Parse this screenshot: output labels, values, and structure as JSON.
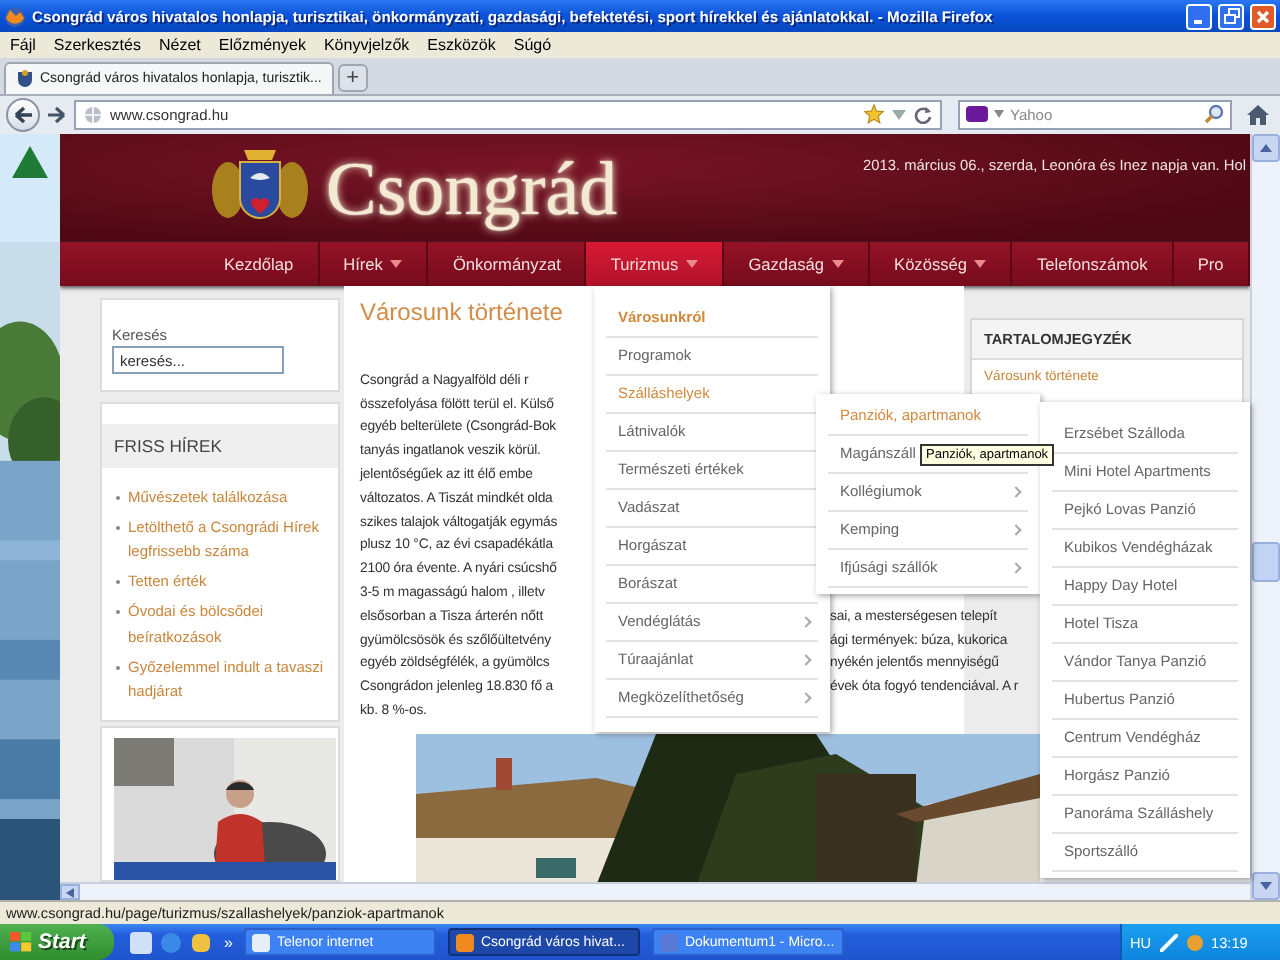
{
  "window": {
    "title": "Csongrád város hivatalos honlapja, turisztikai, önkormányzati, gazdasági, befektetési, sport hírekkel és ajánlatokkal. - Mozilla Firefox"
  },
  "menu_bar": [
    "Fájl",
    "Szerkesztés",
    "Nézet",
    "Előzmények",
    "Könyvjelzők",
    "Eszközök",
    "Súgó"
  ],
  "tabs": [
    {
      "label": "Csongrád város hivatalos honlapja, turisztik...",
      "selected": true
    }
  ],
  "new_tab": "+",
  "address_bar": {
    "url": "www.csongrad.hu"
  },
  "search": {
    "placeholder": "Yahoo"
  },
  "site": {
    "title": "Csongrád",
    "date": "2013. március 06., szerda, Leonóra és Inez napja van. Hol",
    "nav": [
      {
        "label": "Kezdőlap",
        "dropdown": false,
        "selected": false
      },
      {
        "label": "Hírek",
        "dropdown": true,
        "selected": false
      },
      {
        "label": "Önkormányzat",
        "dropdown": false,
        "selected": false
      },
      {
        "label": "Turizmus",
        "dropdown": true,
        "selected": true
      },
      {
        "label": "Gazdaság",
        "dropdown": true,
        "selected": false
      },
      {
        "label": "Közösség",
        "dropdown": true,
        "selected": false
      },
      {
        "label": "Telefonszámok",
        "dropdown": false,
        "selected": false
      },
      {
        "label": "Pro",
        "dropdown": false,
        "selected": false
      }
    ],
    "search": {
      "label": "Keresés",
      "value": "keresés..."
    },
    "news": {
      "heading": "FRISS HÍREK",
      "items": [
        "Művészetek találkozása",
        "Letölthető a Csongrádi Hírek legfrissebb száma",
        "Tetten érték",
        "Óvodai és bölcsődei beíratkozások",
        "Győzelemmel indult a tavaszi hadjárat"
      ]
    },
    "article": {
      "title": "Városunk története",
      "lines": [
        {
          "left": "Csongrád a Nagyalföld déli r"
        },
        {
          "left": "összefolyása fölött terül el. Külső"
        },
        {
          "left": "egyéb belterülete (Csongrád-Bok"
        },
        {
          "left": "tanyás ingatlanok veszik körül."
        },
        {
          "left": "jelentőségűek az itt élő embe"
        },
        {
          "left": "változatos. A Tiszát mindkét olda"
        },
        {
          "left": "szikes talajok váltogatják egymás"
        },
        {
          "left": "plusz 10 °C, az évi csapadékátla"
        },
        {
          "left": "2100 óra évente. A nyári csúcshő"
        },
        {
          "left": "3-5 m magasságú halom , illetv"
        },
        {
          "left": "elsősorban a Tisza árterén nőtt",
          "right": "sai, a mesterségesen telepít"
        },
        {
          "left": "gyümölcsösök és szőlőültetvény",
          "right": "ági termények: búza, kukorica"
        },
        {
          "left": "egyéb zöldségfélék, a gyümölcs",
          "right": "nyékén jelentős mennyiségű"
        },
        {
          "left": "Csongrádon jelenleg 18.830 fő a",
          "right": "évek óta fogyó tendenciával. A r"
        },
        {
          "left": "kb. 8 %-os."
        }
      ]
    },
    "toc": {
      "heading": "TARTALOMJEGYZÉK",
      "items": [
        "Városunk története"
      ]
    },
    "menus": [
      {
        "items": [
          {
            "label": "Városunkról",
            "selected": true,
            "current": true,
            "submenu": false
          },
          {
            "label": "Programok",
            "selected": false,
            "current": false,
            "submenu": false
          },
          {
            "label": "Szálláshelyek",
            "selected": true,
            "current": false,
            "submenu": false
          },
          {
            "label": "Látnivalók",
            "selected": false,
            "current": false,
            "submenu": false
          },
          {
            "label": "Természeti értékek",
            "selected": false,
            "current": false,
            "submenu": false
          },
          {
            "label": "Vadászat",
            "selected": false,
            "current": false,
            "submenu": false
          },
          {
            "label": "Horgászat",
            "selected": false,
            "current": false,
            "submenu": false
          },
          {
            "label": "Borászat",
            "selected": false,
            "current": false,
            "submenu": false
          },
          {
            "label": "Vendéglátás",
            "selected": false,
            "current": false,
            "submenu": true
          },
          {
            "label": "Túraajánlat",
            "selected": false,
            "current": false,
            "submenu": true
          },
          {
            "label": "Megközelíthetőség",
            "selected": false,
            "current": false,
            "submenu": true
          }
        ]
      },
      {
        "items": [
          {
            "label": "Panziók, apartmanok",
            "selected": true,
            "submenu": false
          },
          {
            "label": "Magánszáll",
            "selected": false
          },
          {
            "label": "Kollégiumok",
            "selected": false,
            "submenu": true
          },
          {
            "label": "Kemping",
            "selected": false,
            "submenu": true
          },
          {
            "label": "Ifjúsági szállók",
            "selected": false,
            "submenu": true
          }
        ]
      },
      {
        "items": [
          {
            "label": "Erzsébet Szálloda",
            "selected": false,
            "submenu": false
          },
          {
            "label": "Mini Hotel Apartments",
            "selected": false,
            "submenu": false
          },
          {
            "label": "Pejkó Lovas Panzió",
            "selected": false,
            "submenu": false
          },
          {
            "label": "Kubikos Vendégházak",
            "selected": false,
            "submenu": false
          },
          {
            "label": "Happy Day Hotel",
            "selected": false,
            "submenu": false
          },
          {
            "label": "Hotel Tisza",
            "selected": false,
            "submenu": false
          },
          {
            "label": "Vándor Tanya Panzió",
            "selected": false,
            "submenu": false
          },
          {
            "label": "Hubertus Panzió",
            "selected": false,
            "submenu": false
          },
          {
            "label": "Centrum Vendégház",
            "selected": false,
            "submenu": false
          },
          {
            "label": "Horgász Panzió",
            "selected": false,
            "submenu": false
          },
          {
            "label": "Panoráma Szálláshely",
            "selected": false,
            "submenu": false
          },
          {
            "label": "Sportszálló",
            "selected": false,
            "submenu": false
          }
        ]
      }
    ],
    "tooltip": "Panziók, apartmanok"
  },
  "status_bar": "www.csongrad.hu/page/turizmus/szallashelyek/panziok-apartmanok",
  "taskbar": {
    "start": "Start",
    "overflow": "»",
    "buttons": [
      {
        "label": "Telenor internet",
        "selected": false
      },
      {
        "label": "Csongrád város hivat...",
        "selected": true
      },
      {
        "label": "Dokumentum1 - Micro...",
        "selected": false
      }
    ],
    "language": "HU",
    "clock": "13:19"
  }
}
